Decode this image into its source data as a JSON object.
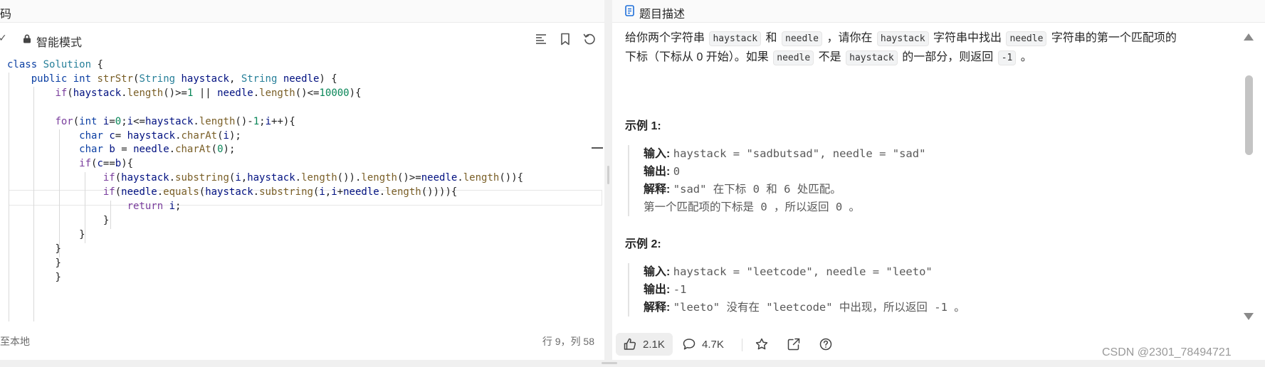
{
  "editor": {
    "title": "码",
    "check_glyph": "✓",
    "mode_label": "智能模式",
    "code_lines": [
      "class Solution {",
      "    public int strStr(String haystack, String needle) {",
      "        if(haystack.length()>=1 || needle.length()<=10000){",
      "",
      "        for(int i=0;i<=haystack.length()-1;i++){",
      "            char c= haystack.charAt(i);",
      "            char b = needle.charAt(0);",
      "            if(c==b){",
      "                if(haystack.substring(i,haystack.length()).length()>=needle.length()){",
      "                if(needle.equals(haystack.substring(i,i+needle.length()))){",
      "                    return i;",
      "                }",
      "            }",
      "        }",
      "        }",
      "        }"
    ],
    "status_left": "至本地",
    "status_right": "行 9，列 58",
    "icons": [
      "lock-icon",
      "format-icon",
      "bookmark-icon",
      "reset-icon"
    ]
  },
  "problem": {
    "tab_label": "题目描述",
    "description": {
      "p1_a": "给你两个字符串",
      "haystack": "haystack",
      "and": "和",
      "needle": "needle",
      "p1_b": "，请你在",
      "p1_c": "字符串中找出",
      "p1_d": "字符串的第一个匹配项的",
      "p2_a": "下标（下标从 0 开始）。如果",
      "p2_b": "不是",
      "p2_c": "的一部分，则返回",
      "minus_one": "-1",
      "period": "。"
    },
    "examples": [
      {
        "title": "示例 1:",
        "input_label": "输入:",
        "input_value": "haystack = \"sadbutsad\", needle = \"sad\"",
        "output_label": "输出:",
        "output_value": "0",
        "explain_label": "解释:",
        "explain_value": "\"sad\" 在下标 0 和 6 处匹配。",
        "explain_value_2": "第一个匹配项的下标是 0 ，所以返回 0 。"
      },
      {
        "title": "示例 2:",
        "input_label": "输入:",
        "input_value": "haystack = \"leetcode\", needle = \"leeto\"",
        "output_label": "输出:",
        "output_value": "-1",
        "explain_label": "解释:",
        "explain_value": "\"leeto\" 没有在 \"leetcode\" 中出现，所以返回 -1 。"
      }
    ],
    "actions": {
      "likes": "2.1K",
      "comments": "4.7K"
    }
  },
  "watermark": "CSDN @2301_78494721"
}
